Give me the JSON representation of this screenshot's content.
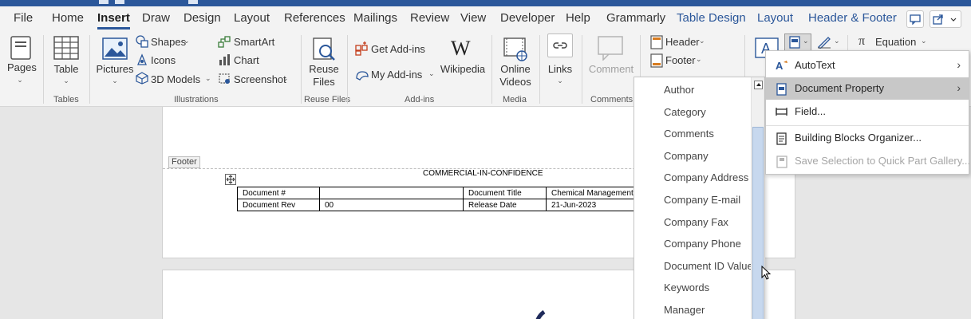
{
  "tabs": [
    {
      "label": "File",
      "state": "normal"
    },
    {
      "label": "Home",
      "state": "normal"
    },
    {
      "label": "Insert",
      "state": "active"
    },
    {
      "label": "Draw",
      "state": "normal"
    },
    {
      "label": "Design",
      "state": "normal"
    },
    {
      "label": "Layout",
      "state": "normal"
    },
    {
      "label": "References",
      "state": "normal"
    },
    {
      "label": "Mailings",
      "state": "normal"
    },
    {
      "label": "Review",
      "state": "normal"
    },
    {
      "label": "View",
      "state": "normal"
    },
    {
      "label": "Developer",
      "state": "normal"
    },
    {
      "label": "Help",
      "state": "normal"
    },
    {
      "label": "Grammarly",
      "state": "normal"
    },
    {
      "label": "Table Design",
      "state": "contextual"
    },
    {
      "label": "Layout",
      "state": "contextual"
    },
    {
      "label": "Header & Footer",
      "state": "contextual"
    }
  ],
  "ribbon": {
    "pages": "Pages",
    "table": "Table",
    "pictures": "Pictures",
    "shapes": "Shapes",
    "icons": "Icons",
    "models3d": "3D Models",
    "smartart": "SmartArt",
    "chart": "Chart",
    "screenshot": "Screenshot",
    "reuse_files_1": "Reuse",
    "reuse_files_2": "Files",
    "get_addins": "Get Add-ins",
    "my_addins": "My Add-ins",
    "wikipedia": "Wikipedia",
    "online_videos_1": "Online",
    "online_videos_2": "Videos",
    "links": "Links",
    "comment": "Comment",
    "header": "Header",
    "footer": "Footer",
    "equation": "Equation",
    "groups": {
      "tables": "Tables",
      "illustrations": "Illustrations",
      "reuse_files": "Reuse Files",
      "addins": "Add-ins",
      "media": "Media",
      "comments": "Comments"
    }
  },
  "document": {
    "footer_tag": "Footer",
    "confidentiality": "COMMERCIAL-IN-CONFIDENCE",
    "table": [
      [
        "Document #",
        "",
        "Document Title",
        "Chemical Management F"
      ],
      [
        "Document Rev",
        "00",
        "Release Date",
        "21-Jun-2023"
      ]
    ]
  },
  "property_list": {
    "items": [
      "Author",
      "Category",
      "Comments",
      "Company",
      "Company Address",
      "Company E-mail",
      "Company Fax",
      "Company Phone",
      "Document ID Value",
      "Keywords",
      "Manager"
    ]
  },
  "quick_parts_menu": {
    "items": [
      {
        "label": "AutoText",
        "submenu": true,
        "highlighted": false,
        "disabled": false
      },
      {
        "label": "Document Property",
        "submenu": true,
        "highlighted": true,
        "disabled": false
      },
      {
        "label": "Field...",
        "submenu": false,
        "highlighted": false,
        "disabled": false
      },
      {
        "label": "Building Blocks Organizer...",
        "submenu": false,
        "highlighted": false,
        "disabled": false
      },
      {
        "label": "Save Selection to Quick Part Gallery...",
        "submenu": false,
        "highlighted": false,
        "disabled": true
      }
    ]
  },
  "colors": {
    "accent": "#2b579a",
    "ribbon_bg": "#f3f3f3",
    "menu_highlight": "#c8c8c8",
    "scroll_thumb": "#c7d8ee"
  }
}
